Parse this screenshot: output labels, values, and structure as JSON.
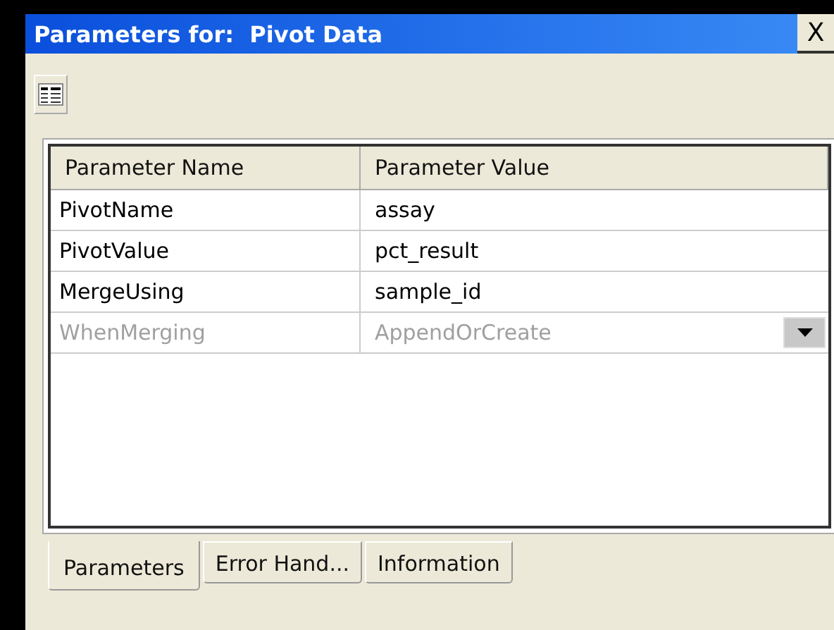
{
  "window": {
    "title": "Parameters for:  Pivot Data",
    "close": "X"
  },
  "table": {
    "columns": [
      "Parameter Name",
      "Parameter Value"
    ],
    "rows": [
      {
        "name": "PivotName",
        "value": "assay",
        "disabled": false,
        "kind": "text"
      },
      {
        "name": "PivotValue",
        "value": "pct_result",
        "disabled": false,
        "kind": "text"
      },
      {
        "name": "MergeUsing",
        "value": "sample_id",
        "disabled": false,
        "kind": "text"
      },
      {
        "name": "WhenMerging",
        "value": "AppendOrCreate",
        "disabled": true,
        "kind": "dropdown"
      }
    ]
  },
  "tabs": [
    {
      "label": "Parameters",
      "selected": true
    },
    {
      "label": "Error Hand...",
      "selected": false
    },
    {
      "label": "Information",
      "selected": false
    }
  ]
}
